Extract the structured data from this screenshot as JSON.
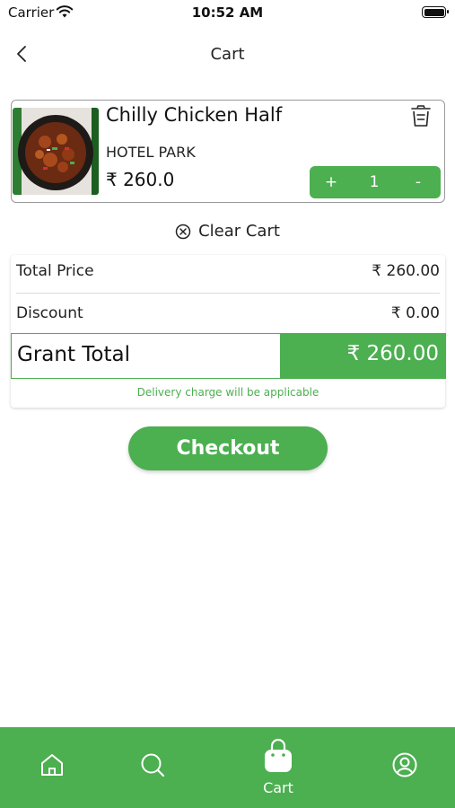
{
  "status_bar": {
    "carrier": "Carrier",
    "time": "10:52 AM"
  },
  "header": {
    "title": "Cart"
  },
  "cart_item": {
    "name": "Chilly Chicken Half",
    "hotel": "HOTEL PARK",
    "price": "₹ 260.0",
    "quantity": "1",
    "plus_label": "+",
    "minus_label": "-"
  },
  "clear_cart_label": "Clear Cart",
  "summary": {
    "total_price_label": "Total Price",
    "total_price_value": "₹ 260.00",
    "discount_label": "Discount",
    "discount_value": "₹ 0.00",
    "grand_total_label": "Grant Total",
    "grand_total_value": "₹ 260.00",
    "delivery_note": "Delivery charge will be applicable"
  },
  "checkout_label": "Checkout",
  "bottom_nav": {
    "items": [
      {
        "icon": "home-icon",
        "label": ""
      },
      {
        "icon": "search-icon",
        "label": ""
      },
      {
        "icon": "cart-bag-icon",
        "label": "Cart"
      },
      {
        "icon": "profile-icon",
        "label": ""
      }
    ],
    "active": "Cart"
  },
  "colors": {
    "accent": "#4caf50",
    "border": "#9a9a9a",
    "text": "#111111"
  }
}
